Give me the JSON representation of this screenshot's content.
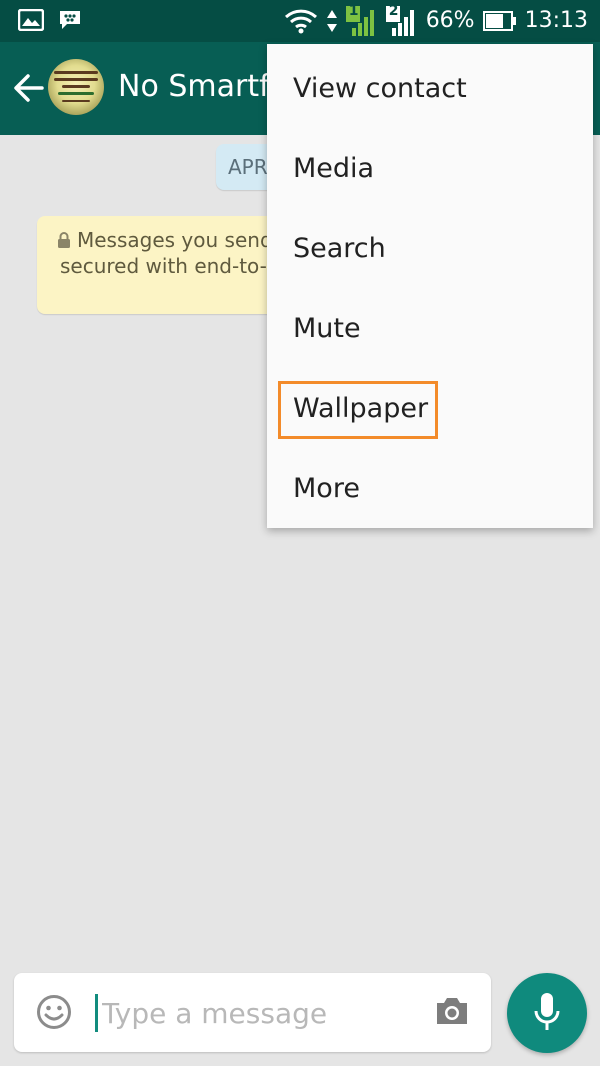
{
  "status_bar": {
    "sim1_label": "1",
    "sim2_label": "2",
    "battery": "66%",
    "time": "13:13",
    "icons": [
      "gallery-icon",
      "bbm-icon",
      "wifi-icon",
      "data-arrows-icon",
      "signal-sim1-icon",
      "signal-sim2-icon",
      "battery-icon"
    ]
  },
  "app_bar": {
    "contact_name": "No Smartfr",
    "avatar_text": "INI BUKAN CERITA... DI DADA KAMI"
  },
  "chat": {
    "date_chip": "APR",
    "encryption_line1": "Messages you send",
    "encryption_line2": "secured with end-to-e"
  },
  "menu": {
    "items": [
      {
        "label": "View contact"
      },
      {
        "label": "Media"
      },
      {
        "label": "Search"
      },
      {
        "label": "Mute"
      },
      {
        "label": "Wallpaper",
        "highlighted": true
      },
      {
        "label": "More"
      }
    ],
    "highlight_color": "#f38b2a"
  },
  "input_bar": {
    "placeholder": "Type a message"
  },
  "colors": {
    "header": "#075e54",
    "status_bar": "#054d44",
    "accent": "#0f8a7d",
    "background": "#e5e5e5"
  }
}
